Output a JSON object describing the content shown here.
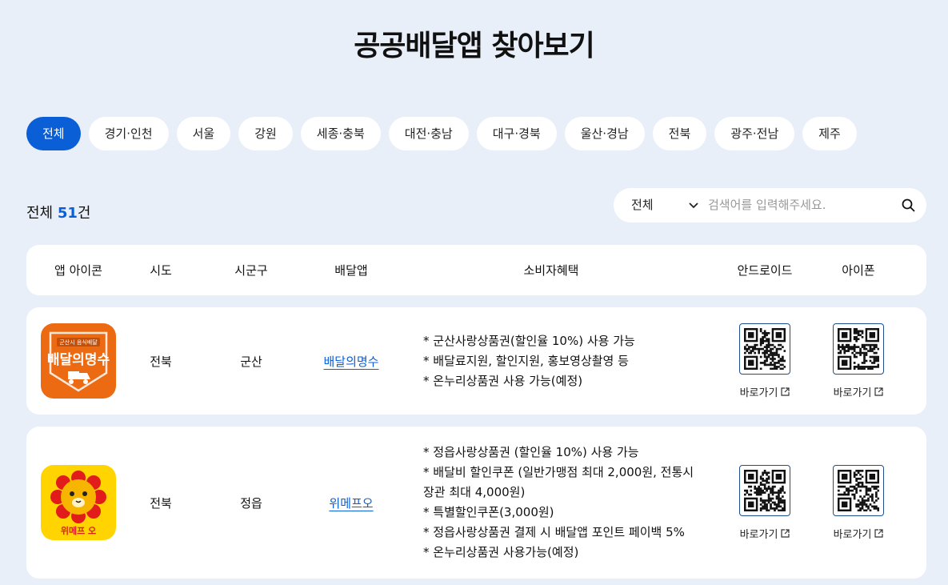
{
  "page": {
    "title": "공공배달앱 찾아보기"
  },
  "tabs": [
    {
      "label": "전체",
      "active": true
    },
    {
      "label": "경기·인천"
    },
    {
      "label": "서울"
    },
    {
      "label": "강원"
    },
    {
      "label": "세종·충북"
    },
    {
      "label": "대전·충남"
    },
    {
      "label": "대구·경북"
    },
    {
      "label": "울산·경남"
    },
    {
      "label": "전북"
    },
    {
      "label": "광주·전남"
    },
    {
      "label": "제주"
    }
  ],
  "summary": {
    "prefix": "전체",
    "count": "51",
    "suffix": "건"
  },
  "search": {
    "select_value": "전체",
    "placeholder": "검색어를 입력해주세요."
  },
  "table": {
    "headers": [
      "앱 아이콘",
      "시도",
      "시군구",
      "배달앱",
      "소비자혜택",
      "안드로이드",
      "아이폰"
    ],
    "rows": [
      {
        "icon": "baedal-myeongsu-logo",
        "icon_text_small": "군산시 음식배달",
        "icon_text_big": "배달의명수",
        "sido": "전북",
        "sigungu": "군산",
        "app": "배달의명수",
        "benefits": [
          "* 군산사랑상품권(할인율 10%) 사용 가능",
          "* 배달료지원, 할인지원, 홍보영상촬영 등",
          "* 온누리상품권 사용 가능(예정)"
        ],
        "android_link": "바로가기",
        "ios_link": "바로가기"
      },
      {
        "icon": "wemepo-logo",
        "icon_text_big": "위메프 오",
        "sido": "전북",
        "sigungu": "정읍",
        "app": "위메프오",
        "benefits": [
          "* 정읍사랑상품권 (할인율 10%) 사용 가능",
          "* 배달비 할인쿠폰 (일반가맹점 최대 2,000원, 전통시",
          "장관 최대 4,000원)",
          "* 특별할인쿠폰(3,000원)",
          "* 정읍사랑상품권 결제 시 배달앱 포인트 페이백 5%",
          "* 온누리상품권 사용가능(예정)"
        ],
        "android_link": "바로가기",
        "ios_link": "바로가기"
      }
    ]
  },
  "colors": {
    "accent": "#0b5fd6",
    "background": "#e9eff8",
    "row_bg": "#ffffff",
    "qr_border": "#1e4f8c"
  }
}
